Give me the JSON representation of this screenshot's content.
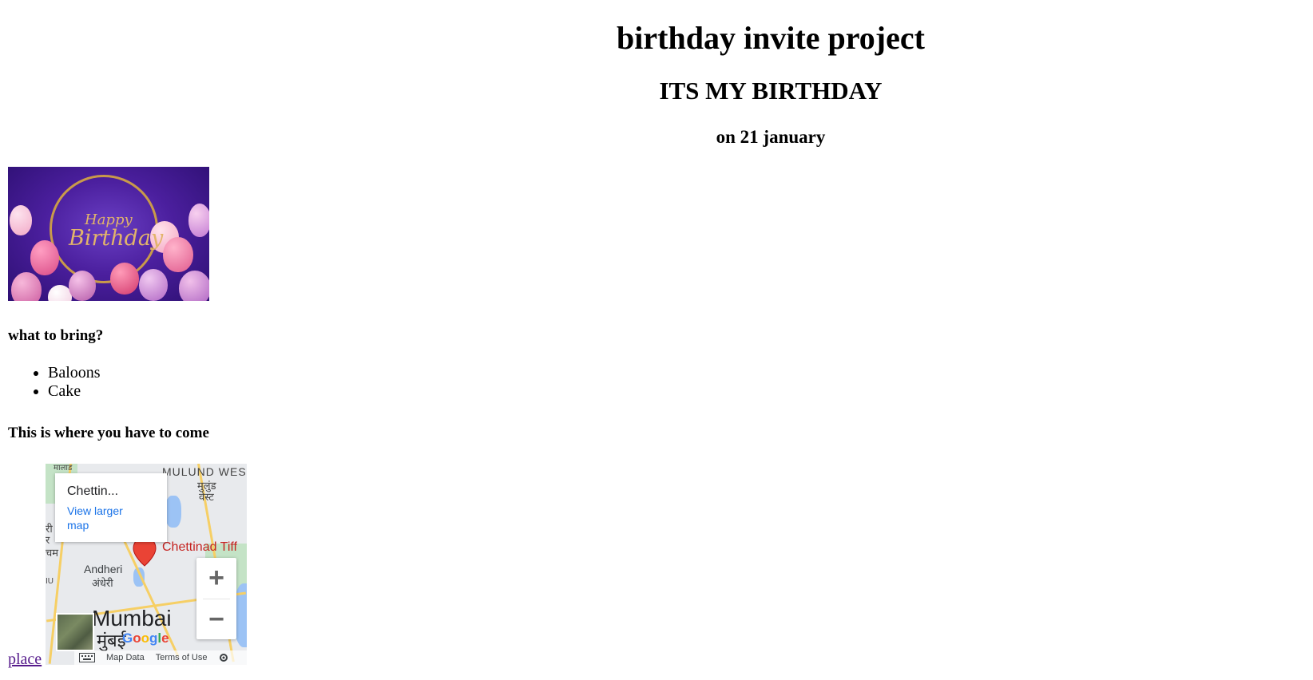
{
  "page": {
    "title": "birthday invite project",
    "subtitle": "ITS MY BIRTHDAY",
    "date": "on 21 january"
  },
  "banner": {
    "line1": "Happy",
    "line2": "Birthday"
  },
  "bring": {
    "heading": "what to bring?",
    "items": [
      "Baloons",
      "Cake"
    ]
  },
  "location": {
    "heading": "This is where you have to come",
    "link_label": "place"
  },
  "map": {
    "info_title": "Chettin...",
    "info_link": "View larger map",
    "place_label": "Chettinad Tiff",
    "labels": {
      "top_area": "MULUND WES",
      "top_area_local1": "मुलुंड",
      "top_area_local2": "वेस्ट",
      "topleft": "मालाड",
      "andheri": "Andheri",
      "andheri_local": "अंधेरी",
      "city": "Mumbai",
      "city_local": "मुंबई",
      "left1": "री",
      "left2": "र",
      "left3": "चम",
      "left4": "IU"
    },
    "zoom_in": "+",
    "zoom_out": "−",
    "footer": {
      "map_data": "Map Data",
      "terms": "Terms of Use"
    },
    "logo": "Google"
  }
}
